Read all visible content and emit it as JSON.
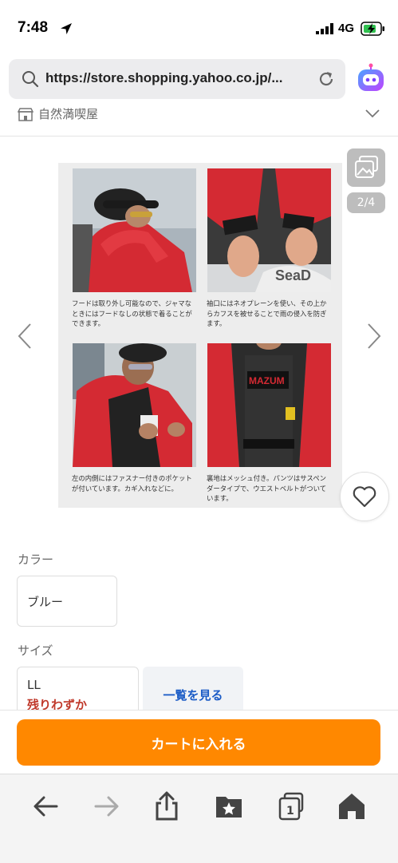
{
  "status_bar": {
    "time": "7:48",
    "network": "4G"
  },
  "browser": {
    "url": "https://store.shopping.yahoo.co.jp/..."
  },
  "store": {
    "name": "自然満喫屋"
  },
  "gallery": {
    "counter": "2/4",
    "captions": [
      "フードは取り外し可能なので、ジャマなときにはフードなしの状態で着ることができます。",
      "袖口にはネオプレーンを使い、その上からカフスを被せることで雨の侵入を防ぎます。",
      "左の内側にはファスナー付きのポケットが付いています。カギ入れなどに。",
      "裏地はメッシュ付き。パンツはサスペンダータイプで、ウエストベルトがついています。"
    ]
  },
  "options": {
    "color_label": "カラー",
    "color_value": "ブルー",
    "size_label": "サイズ",
    "size_value": "LL",
    "size_stock": "残りわずか",
    "list_button": "一覧を見る"
  },
  "cart": {
    "button": "カートに入れる"
  },
  "colors": {
    "accent": "#ff8800",
    "link": "#1a5bc6",
    "stock": "#c0392b"
  }
}
